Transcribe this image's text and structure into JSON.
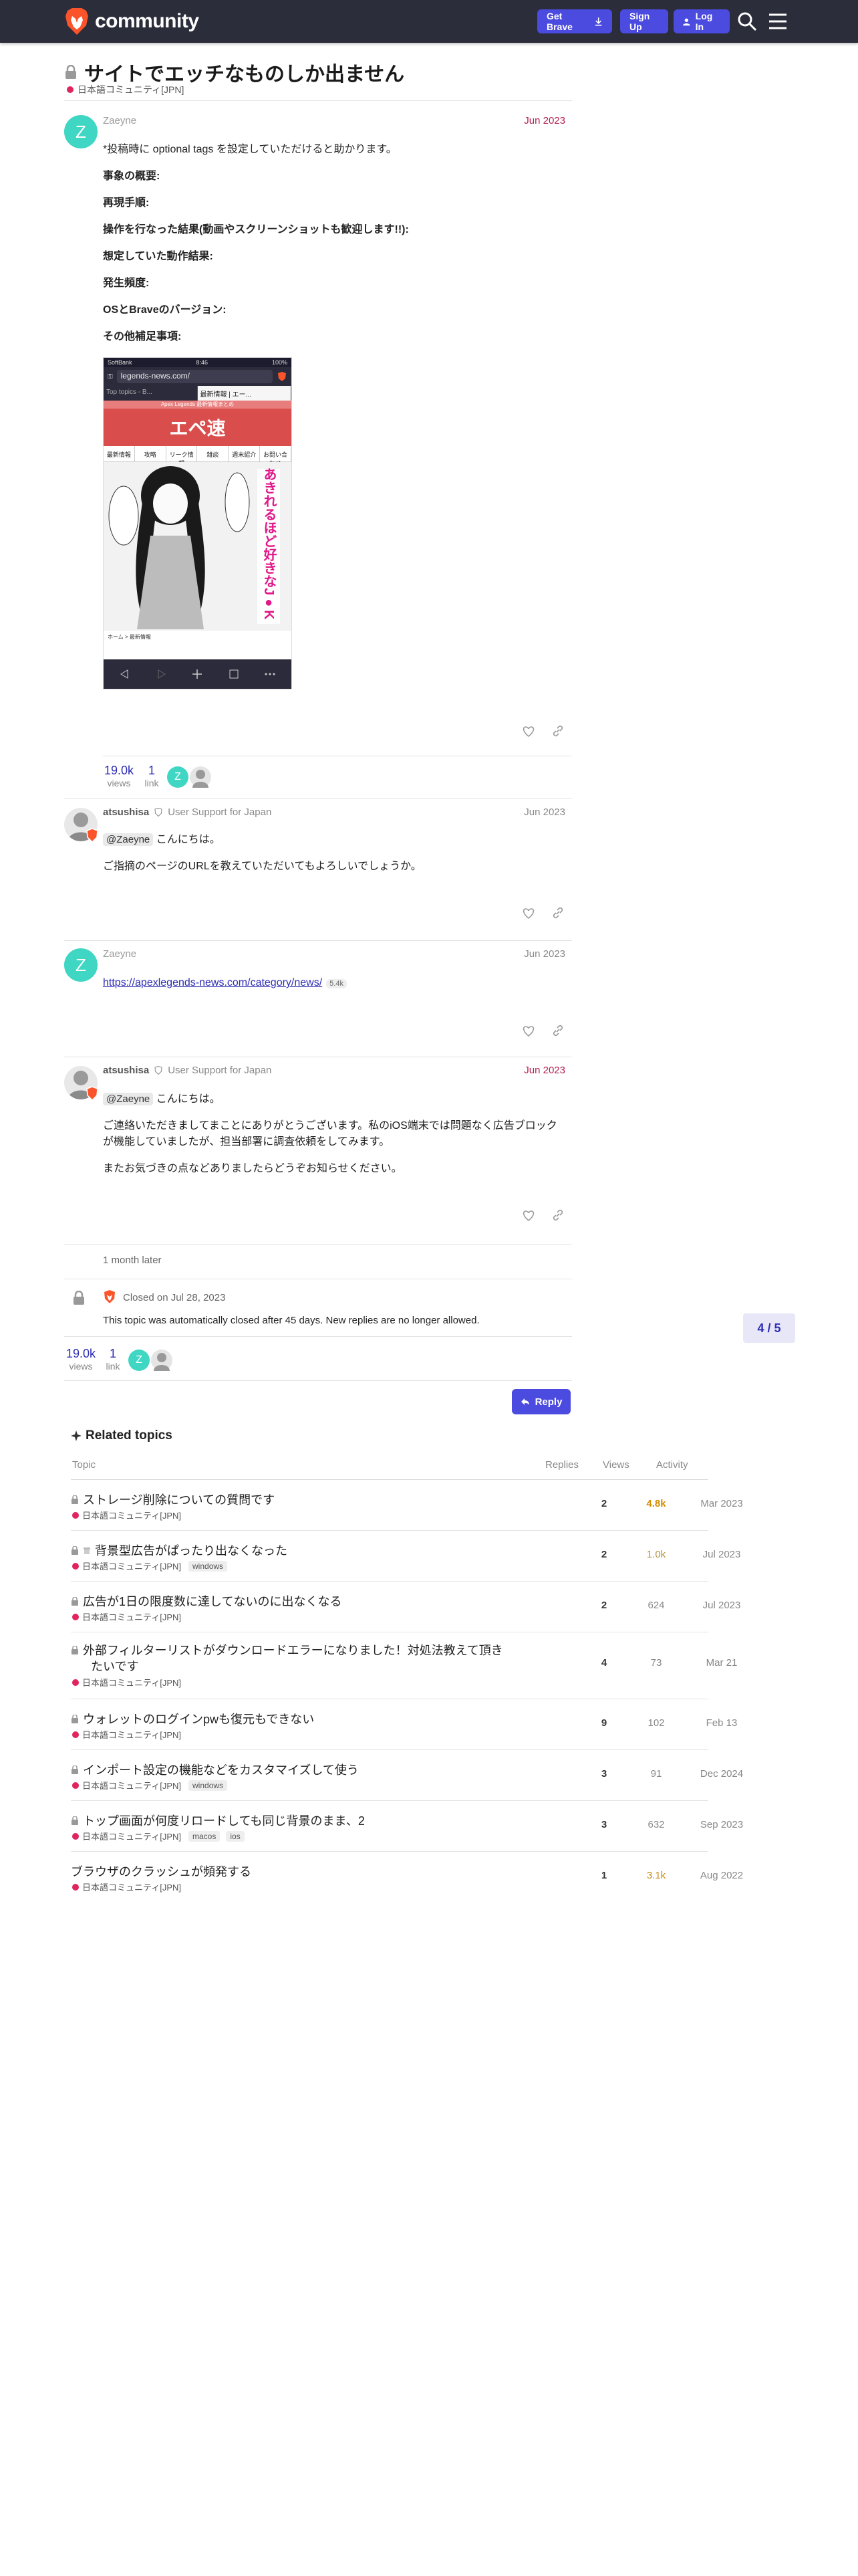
{
  "header": {
    "logo_text": "community",
    "get_brave": "Get Brave",
    "sign_up": "Sign Up",
    "log_in": "Log In"
  },
  "topic": {
    "title": "サイトでエッチなものしか出ません",
    "category": "日本語コミュニティ[JPN]"
  },
  "posts": [
    {
      "username": "Zaeyne",
      "date": "Jun 2023",
      "lines": [
        "*投稿時に optional tags を設定していただけると助かります。"
      ],
      "headings": [
        "事象の概要:",
        "再現手順:",
        "操作を行なった結果(動画やスクリーンショットも歓迎します!!):",
        "想定していた動作結果:",
        "発生頻度:",
        "OSとBraveのバージョン:",
        "その他補足事項:"
      ],
      "screenshot": {
        "status_left": "SoftBank",
        "status_time": "8:46",
        "status_right": "100%",
        "url": "legends-news.com/",
        "tab1": "Top topics - B...",
        "tab2": "最新情報 | エー...",
        "banner_text": "Apex Legends 最新情報まとめ",
        "site_logo": "エペ速",
        "nav": [
          "最新情報",
          "攻略",
          "リーク情報",
          "雑談",
          "週末紹介",
          "お問い合わせ"
        ],
        "manga_caption": "あきれるほど好きなJ●K",
        "breadcrumb": "ホーム > 最新情報"
      },
      "views": "19.0k",
      "views_label": "views",
      "link_count": "1",
      "link_label": "link"
    },
    {
      "username": "atsushisa",
      "user_title": "User Support for Japan",
      "date": "Jun 2023",
      "mention": "@Zaeyne",
      "greeting": "こんにちは。",
      "lines": [
        "ご指摘のページのURLを教えていただいてもよろしいでしょうか。"
      ]
    },
    {
      "username": "Zaeyne",
      "date": "Jun 2023",
      "link": "https://apexlegends-news.com/category/news/",
      "link_clicks": "5.4k"
    },
    {
      "username": "atsushisa",
      "user_title": "User Support for Japan",
      "date": "Jun 2023",
      "mention": "@Zaeyne",
      "greeting": "こんにちは。",
      "lines": [
        "ご連絡いただきましてまことにありがとうございます。私のiOS端末では問題なく広告ブロック",
        "が機能していましたが、担当部署に調査依頼をしてみます。",
        "またお気づきの点などありましたらどうぞお知らせください。"
      ]
    }
  ],
  "time_gap": "1 month later",
  "closed": {
    "label": "Closed on Jul 28, 2023",
    "message": "This topic was automatically closed after 45 days. New replies are no longer allowed."
  },
  "summary": {
    "views": "19.0k",
    "views_label": "views",
    "links": "1",
    "links_label": "link"
  },
  "progress": "4 / 5",
  "reply_label": "Reply",
  "related": {
    "title": "Related topics",
    "columns": [
      "Topic",
      "Replies",
      "Views",
      "Activity"
    ],
    "rows": [
      {
        "title": "ストレージ削除についての質問です",
        "category": "日本語コミュニティ[JPN]",
        "tags": [],
        "replies": "2",
        "views": "4.8k",
        "activity": "Mar 2023"
      },
      {
        "title": "背景型広告がぱったり出なくなった",
        "category": "日本語コミュニティ[JPN]",
        "tags": [
          "windows"
        ],
        "replies": "2",
        "views": "1.0k",
        "activity": "Jul 2023"
      },
      {
        "title": "広告が1日の限度数に達してないのに出なくなる",
        "category": "日本語コミュニティ[JPN]",
        "tags": [],
        "replies": "2",
        "views": "624",
        "activity": "Jul 2023"
      },
      {
        "title": "外部フィルターリストがダウンロードエラーになりました！対処法教えて頂き",
        "title2": "たいです",
        "category": "日本語コミュニティ[JPN]",
        "tags": [],
        "replies": "4",
        "views": "73",
        "activity": "Mar 21"
      },
      {
        "title": "ウォレットのログインpwも復元もできない",
        "category": "日本語コミュニティ[JPN]",
        "tags": [],
        "replies": "9",
        "views": "102",
        "activity": "Feb 13"
      },
      {
        "title": "インポート設定の機能などをカスタマイズして使う",
        "category": "日本語コミュニティ[JPN]",
        "tags": [
          "windows"
        ],
        "replies": "3",
        "views": "91",
        "activity": "Dec 2024"
      },
      {
        "title": "トップ画面が何度リロードしても同じ背景のまま、2",
        "category": "日本語コミュニティ[JPN]",
        "tags": [
          "macos",
          "ios"
        ],
        "replies": "3",
        "views": "632",
        "activity": "Sep 2023"
      },
      {
        "title": "ブラウザのクラッシュが頻発する",
        "category": "日本語コミュニティ[JPN]",
        "tags": [],
        "replies": "1",
        "views": "3.1k",
        "activity": "Aug 2022"
      }
    ]
  },
  "colors": {
    "header_bg": "#2b2d3a",
    "accent": "#4b4be0",
    "category": "#e0245e",
    "new_date": "#b1204f",
    "hot_views": "#d28c00"
  }
}
